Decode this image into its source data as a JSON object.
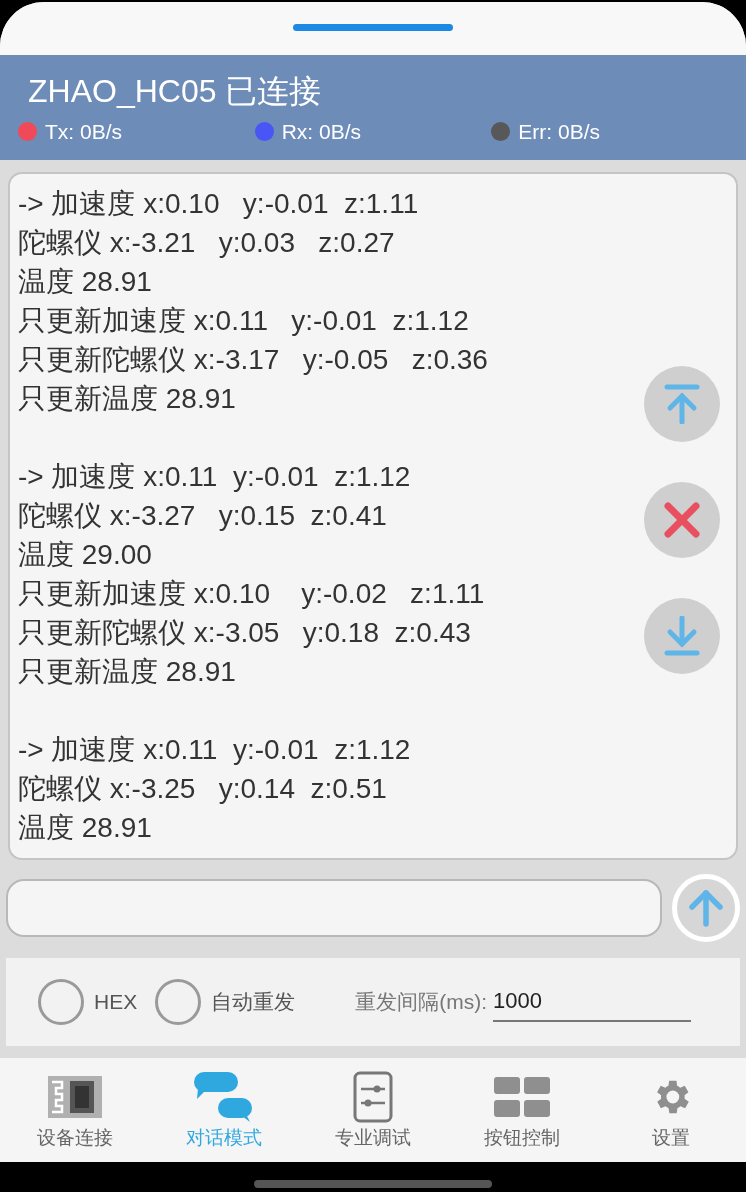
{
  "header": {
    "title": "ZHAO_HC05 已连接",
    "stats": [
      {
        "label": "Tx: 0B/s",
        "color": "#f0495a"
      },
      {
        "label": "Rx: 0B/s",
        "color": "#4a55f5"
      },
      {
        "label": "Err: 0B/s",
        "color": "#585858"
      }
    ]
  },
  "log": {
    "blocks": [
      {
        "lines": [
          "-> 加速度 x:0.10   y:-0.01  z:1.11",
          "陀螺仪 x:-3.21   y:0.03   z:0.27",
          "温度 28.91",
          "只更新加速度 x:0.11   y:-0.01  z:1.12",
          "只更新陀螺仪 x:-3.17   y:-0.05   z:0.36",
          "只更新温度 28.91"
        ]
      },
      {
        "lines": [
          "-> 加速度 x:0.11  y:-0.01  z:1.12",
          "陀螺仪 x:-3.27   y:0.15  z:0.41",
          "温度 29.00",
          "只更新加速度 x:0.10    y:-0.02   z:1.11",
          "只更新陀螺仪 x:-3.05   y:0.18  z:0.43",
          "只更新温度 28.91"
        ]
      },
      {
        "lines": [
          "-> 加速度 x:0.11  y:-0.01  z:1.12",
          "陀螺仪 x:-3.25   y:0.14  z:0.51",
          "温度 28.91"
        ]
      }
    ],
    "actions": [
      {
        "kind": "top"
      },
      {
        "kind": "clear"
      },
      {
        "kind": "bottom"
      }
    ]
  },
  "options": {
    "checks": [
      {
        "label": "HEX",
        "checked": false
      },
      {
        "label": "自动重发",
        "checked": false
      }
    ],
    "interval_label": "重发间隔(ms):",
    "interval_value": "1000"
  },
  "nav": [
    {
      "kind": "device",
      "label": "设备连接",
      "selected": false
    },
    {
      "kind": "chat",
      "label": "对话模式",
      "selected": true
    },
    {
      "kind": "debug",
      "label": "专业调试",
      "selected": false
    },
    {
      "kind": "buttons",
      "label": "按钮控制",
      "selected": false
    },
    {
      "kind": "settings",
      "label": "设置",
      "selected": false
    }
  ]
}
